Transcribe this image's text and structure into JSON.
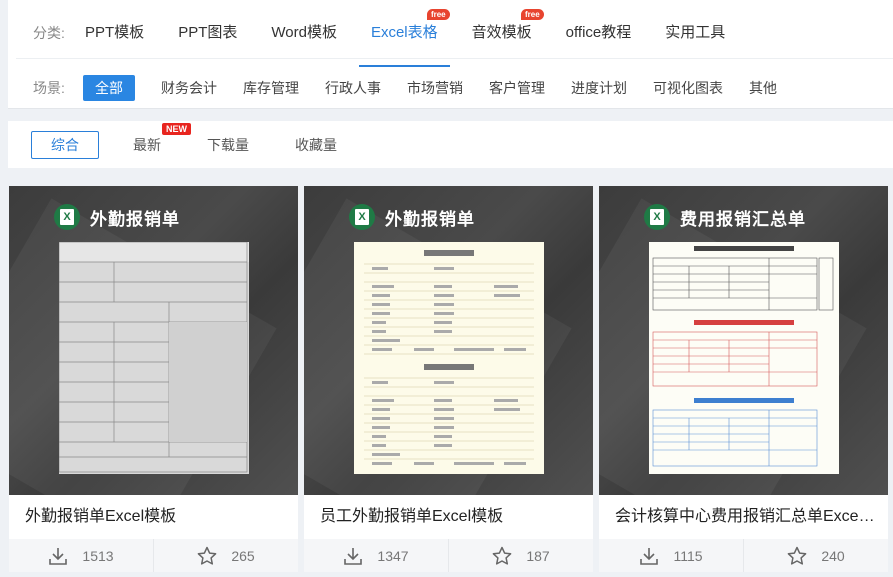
{
  "categories": {
    "label": "分类:",
    "items": [
      {
        "label": "PPT模板",
        "free": ""
      },
      {
        "label": "PPT图表",
        "free": ""
      },
      {
        "label": "Word模板",
        "free": ""
      },
      {
        "label": "Excel表格",
        "free": "free",
        "active": true
      },
      {
        "label": "音效模板",
        "free": "free"
      },
      {
        "label": "office教程",
        "free": ""
      },
      {
        "label": "实用工具",
        "free": ""
      }
    ]
  },
  "scenes": {
    "label": "场景:",
    "items": [
      "全部",
      "财务会计",
      "库存管理",
      "行政人事",
      "市场营销",
      "客户管理",
      "进度计划",
      "可视化图表",
      "其他"
    ]
  },
  "sort": {
    "items": [
      "综合",
      "最新",
      "下载量",
      "收藏量"
    ],
    "new_badge": "NEW"
  },
  "cards": [
    {
      "thumb_title": "外勤报销单",
      "name": "外勤报销单Excel模板",
      "downloads": "1513",
      "favorites": "265"
    },
    {
      "thumb_title": "外勤报销单",
      "name": "员工外勤报销单Excel模板",
      "downloads": "1347",
      "favorites": "187"
    },
    {
      "thumb_title": "费用报销汇总单",
      "name": "会计核算中心费用报销汇总单Excel模板",
      "downloads": "1115",
      "favorites": "240"
    }
  ]
}
